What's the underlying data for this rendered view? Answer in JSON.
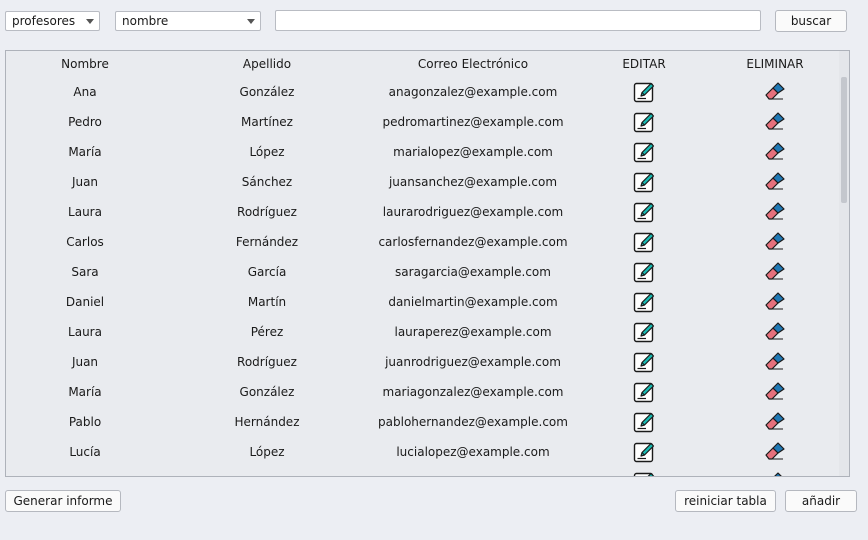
{
  "filters": {
    "category_value": "profesores",
    "field_value": "nombre",
    "search_value": ""
  },
  "search_button_label": "buscar",
  "table": {
    "columns": [
      "Nombre",
      "Apellido",
      "Correo Electrónico",
      "EDITAR",
      "ELIMINAR"
    ],
    "rows": [
      {
        "nombre": "Ana",
        "apellido": "González",
        "correo": "anagonzalez@example.com"
      },
      {
        "nombre": "Pedro",
        "apellido": "Martínez",
        "correo": "pedromartinez@example.com"
      },
      {
        "nombre": "María",
        "apellido": "López",
        "correo": "marialopez@example.com"
      },
      {
        "nombre": "Juan",
        "apellido": "Sánchez",
        "correo": "juansanchez@example.com"
      },
      {
        "nombre": "Laura",
        "apellido": "Rodríguez",
        "correo": "laurarodriguez@example.com"
      },
      {
        "nombre": "Carlos",
        "apellido": "Fernández",
        "correo": "carlosfernandez@example.com"
      },
      {
        "nombre": "Sara",
        "apellido": "García",
        "correo": "saragarcia@example.com"
      },
      {
        "nombre": "Daniel",
        "apellido": "Martín",
        "correo": "danielmartin@example.com"
      },
      {
        "nombre": "Laura",
        "apellido": "Pérez",
        "correo": "lauraperez@example.com"
      },
      {
        "nombre": "Juan",
        "apellido": "Rodríguez",
        "correo": "juanrodriguez@example.com"
      },
      {
        "nombre": "María",
        "apellido": "González",
        "correo": "mariagonzalez@example.com"
      },
      {
        "nombre": "Pablo",
        "apellido": "Hernández",
        "correo": "pablohernandez@example.com"
      },
      {
        "nombre": "Lucía",
        "apellido": "López",
        "correo": "lucialopez@example.com"
      },
      {
        "nombre": "",
        "apellido": "",
        "correo": ""
      }
    ],
    "edit_icon": "pencil-edit-icon",
    "delete_icon": "eraser-delete-icon"
  },
  "footer": {
    "report_button_label": "Generar informe",
    "reset_button_label": "reiniciar tabla",
    "add_button_label": "añadir"
  },
  "colors": {
    "edit_icon_accent": "#18b8b0",
    "eraser_blue": "#1f78b4",
    "eraser_pink": "#e8707c"
  }
}
